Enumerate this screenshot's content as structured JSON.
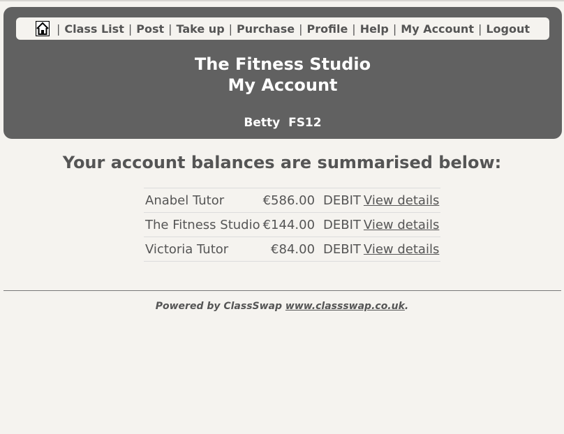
{
  "nav": {
    "home_icon": "home-icon",
    "items": [
      "Class List",
      "Post",
      "Take up",
      "Purchase",
      "Profile",
      "Help",
      "My Account",
      "Logout"
    ]
  },
  "header": {
    "site_name": "The Fitness Studio",
    "page_name": "My Account",
    "user_name": "Betty",
    "user_code": "FS12"
  },
  "main": {
    "heading": "Your account balances are summarised below:",
    "balances": [
      {
        "name": "Anabel Tutor",
        "amount": "€586.00",
        "type": "DEBIT",
        "link": "View details"
      },
      {
        "name": "The Fitness Studio",
        "amount": "€144.00",
        "type": "DEBIT",
        "link": "View details"
      },
      {
        "name": "Victoria Tutor",
        "amount": "€84.00",
        "type": "DEBIT",
        "link": "View details"
      }
    ]
  },
  "footer": {
    "powered_by": "Powered by ClassSwap",
    "url": "www.classswap.co.uk",
    "end": "."
  },
  "colors": {
    "page_bg": "#f5f3ef",
    "header_bg": "#616161",
    "text": "#555555"
  }
}
